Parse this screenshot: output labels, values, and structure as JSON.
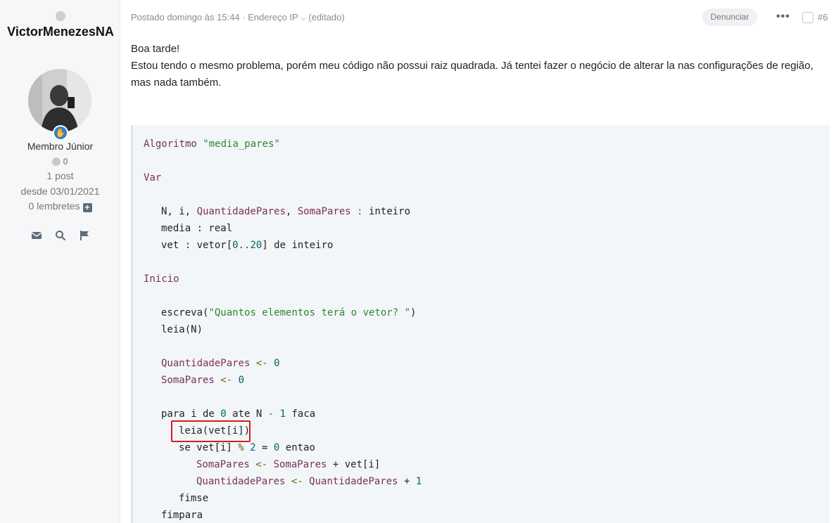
{
  "author": {
    "username": "VictorMenezesNA",
    "rank_title": "Membro Júnior",
    "reputation": "0",
    "post_count": "1 post",
    "joined": "desde 03/01/2021",
    "reminders": "0 lembretes"
  },
  "post": {
    "meta_posted": "Postado domingo às 15:44",
    "meta_separator": " · ",
    "meta_ip": "Endereço IP",
    "meta_edited": "(editado)",
    "report_label": "Denunciar",
    "more_label": "•••",
    "post_number": "#6",
    "body_line1": "Boa tarde!",
    "body_line2": "Estou tendo o mesmo problema, porém meu código não possui raiz quadrada. Já tentei fazer o negócio de alterar la nas configurações de região,",
    "body_line3": "mas nada também."
  },
  "code": {
    "l1_kw": "Algoritmo",
    "l1_str": "\"media_pares\"",
    "l2_kw": "Var",
    "l3_a": "N, i, ",
    "l3_b": "QuantidadePares",
    "l3_c": ", ",
    "l3_d": "SomaPares",
    "l3_e": " : ",
    "l3_f": "inteiro",
    "l4": "media : real",
    "l5_a": "vet : vetor[",
    "l5_b": "0..20",
    "l5_c": "] de inteiro",
    "l6_kw": "Inicio",
    "l7_a": "escreva(",
    "l7_b": "\"Quantos elementos terá o vetor? \"",
    "l7_c": ")",
    "l8": "leia(N)",
    "l9_a": "QuantidadePares",
    "l9_b": " <- ",
    "l9_c": "0",
    "l10_a": "SomaPares",
    "l10_b": " <- ",
    "l10_c": "0",
    "l11_a": "para i de ",
    "l11_b": "0",
    "l11_c": " ate N ",
    "l11_d": "-",
    "l11_e": " ",
    "l11_f": "1",
    "l11_g": " faca",
    "l12": "leia(vet[i])",
    "l13_a": "se vet[i] ",
    "l13_b": "%",
    "l13_c": " ",
    "l13_d": "2",
    "l13_e": " = ",
    "l13_f": "0",
    "l13_g": " entao",
    "l14_a": "SomaPares",
    "l14_b": " <- ",
    "l14_c": "SomaPares",
    "l14_d": " + vet[i]",
    "l15_a": "QuantidadePares",
    "l15_b": " <- ",
    "l15_c": "QuantidadePares",
    "l15_d": " + ",
    "l15_e": "1",
    "l16": "fimse",
    "l17": "fimpara"
  },
  "colors": {
    "keyword": "#79305a",
    "string": "#2a8a2a",
    "number": "#006666",
    "highlight_border": "#d91a1a",
    "rank_badge": "#2f7fd0"
  },
  "icons": [
    "envelope-icon",
    "search-icon",
    "flag-icon",
    "hand-icon",
    "plus-icon",
    "ellipsis-icon",
    "chevron-down-icon"
  ]
}
